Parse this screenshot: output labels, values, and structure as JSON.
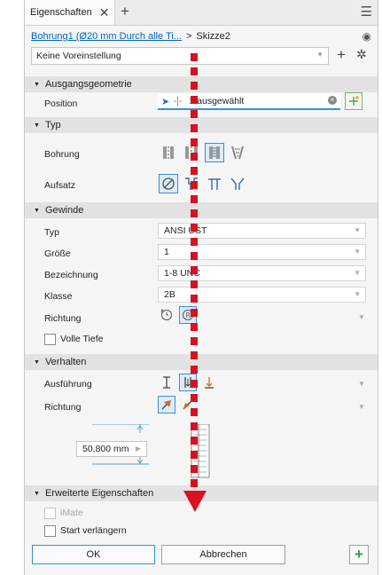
{
  "tab": {
    "title": "Eigenschaften",
    "close": "✕",
    "add": "+",
    "menu": "☰"
  },
  "breadcrumb": {
    "link": "Bohrung1 (Ø20 mm Durch alle Ti...",
    "sep": ">",
    "item": "Skizze2"
  },
  "preset": {
    "value": "Keine Voreinstellung"
  },
  "sections": {
    "geometry": "Ausgangsgeometrie",
    "type": "Typ",
    "thread": "Gewinde",
    "behavior": "Verhalten",
    "advanced": "Erweiterte Eigenschaften"
  },
  "geometry": {
    "position_label": "Position",
    "position_value": "1 ausgewählt"
  },
  "type": {
    "hole_label": "Bohrung",
    "seat_label": "Aufsatz"
  },
  "thread": {
    "type_label": "Typ",
    "type_value": "ANSI UST",
    "size_label": "Größe",
    "size_value": "1",
    "designation_label": "Bezeichnung",
    "designation_value": "1-8 UNC",
    "class_label": "Klasse",
    "class_value": "2B",
    "direction_label": "Richtung",
    "full_depth_label": "Volle Tiefe"
  },
  "behavior": {
    "execution_label": "Ausführung",
    "direction_label": "Richtung",
    "dimension_value": "50,800 mm"
  },
  "advanced": {
    "imate_label": "iMate",
    "extend_start_label": "Start verlängern"
  },
  "buttons": {
    "ok": "OK",
    "cancel": "Abbrechen",
    "add": "+"
  },
  "colors": {
    "accent": "#3a8fd6",
    "link": "#0064c8",
    "annotation": "#d81020",
    "ok_green": "#2e9e3a"
  }
}
